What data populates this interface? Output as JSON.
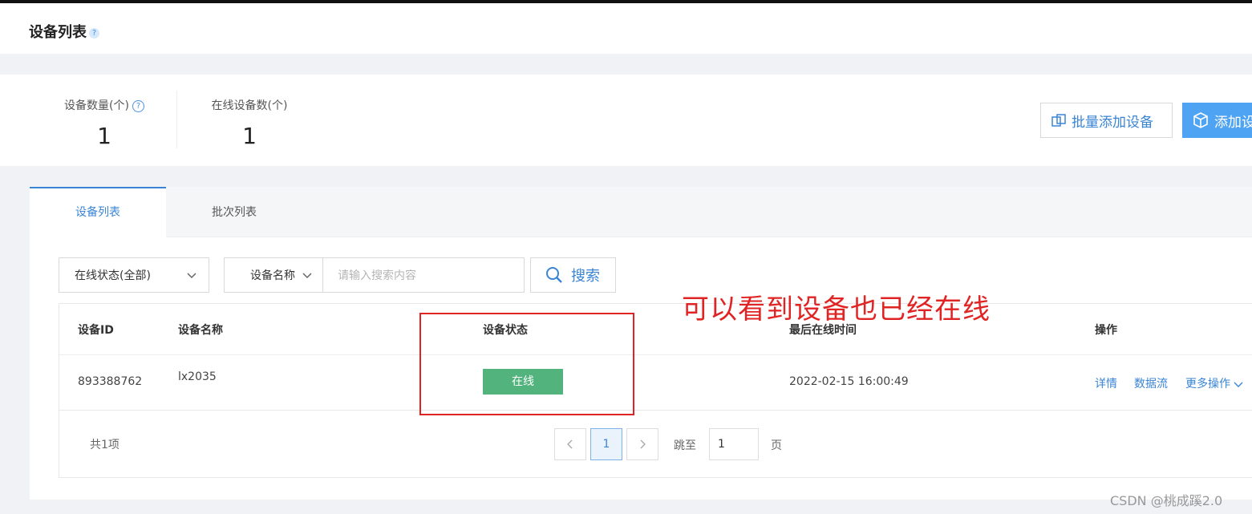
{
  "page": {
    "title": "设备列表",
    "help_glyph": "?"
  },
  "stats": {
    "device_count_label": "设备数量(个)",
    "device_count": "1",
    "online_count_label": "在线设备数(个)",
    "online_count": "1",
    "help_glyph": "?"
  },
  "actions": {
    "batch_add_label": "批量添加设备",
    "add_label": "添加设"
  },
  "tabs": [
    {
      "label": "设备列表",
      "active": true
    },
    {
      "label": "批次列表",
      "active": false
    }
  ],
  "filters": {
    "status_select": "在线状态(全部)",
    "field_select": "设备名称",
    "search_placeholder": "请输入搜索内容",
    "search_button": "搜索"
  },
  "table": {
    "columns": [
      "设备ID",
      "设备名称",
      "设备状态",
      "最后在线时间",
      "操作"
    ],
    "rows": [
      {
        "device_id": "893388762",
        "device_name": "lx2035",
        "status": "在线",
        "last_online": "2022-02-15 16:00:49",
        "actions": [
          "详情",
          "数据流",
          "更多操作"
        ]
      }
    ]
  },
  "pagination": {
    "total": "共1项",
    "current_page": "1",
    "jump_label": "跳至",
    "jump_value": "1",
    "page_unit": "页"
  },
  "annotation": {
    "text": "可以看到设备也已经在线"
  },
  "watermark": "CSDN @桃成蹊2.0",
  "colors": {
    "accent": "#3a84d6",
    "online": "#52b37c",
    "annotation": "#e02424",
    "primary_button": "#4fa3f3"
  }
}
